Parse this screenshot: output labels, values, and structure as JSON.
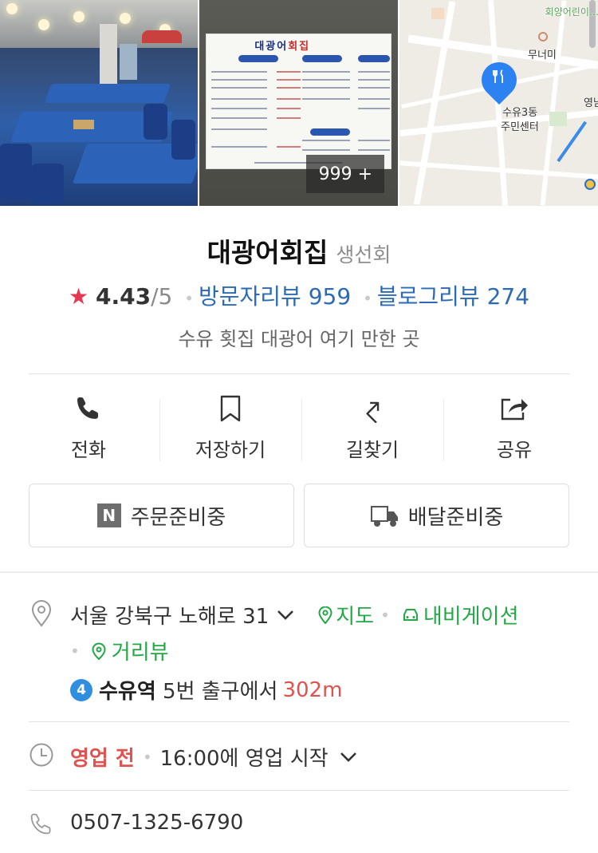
{
  "photos": {
    "count_label": "999 +",
    "menu_board_title_part1": "대광어",
    "menu_board_title_part2": "회집",
    "map_labels": {
      "top": "회양어린이…",
      "place1": "무너미",
      "place2": "수유3동",
      "place3": "주민센터",
      "edge": "영남"
    }
  },
  "place": {
    "name": "대광어회집",
    "category": "생선회",
    "rating": "4.43",
    "rating_max": "/5",
    "visitor_review_label": "방문자리뷰 959",
    "blog_review_label": "블로그리뷰 274",
    "tagline": "수유 횟집 대광어 여기 만한 곳"
  },
  "actions": [
    {
      "label": "전화",
      "icon": "phone-icon"
    },
    {
      "label": "저장하기",
      "icon": "bookmark-icon"
    },
    {
      "label": "길찾기",
      "icon": "directions-icon"
    },
    {
      "label": "공유",
      "icon": "share-icon"
    }
  ],
  "booking": {
    "order_badge": "N",
    "order_label": "주문준비중",
    "delivery_label": "배달준비중"
  },
  "address": {
    "text": "서울 강북구 노해로 31",
    "map_link": "지도",
    "navigation_link": "내비게이션",
    "street_view_link": "거리뷰"
  },
  "subway": {
    "line": "4",
    "station": "수유역",
    "exit_text": "5번 출구에서",
    "distance": "302m"
  },
  "hours": {
    "status": "영업 전",
    "text": "16:00에 영업 시작"
  },
  "phone": "0507-1325-6790",
  "colors": {
    "link_blue": "#2b6bb5",
    "link_green": "#22a845",
    "status_red": "#e0524f",
    "star_red": "#e8384f"
  }
}
